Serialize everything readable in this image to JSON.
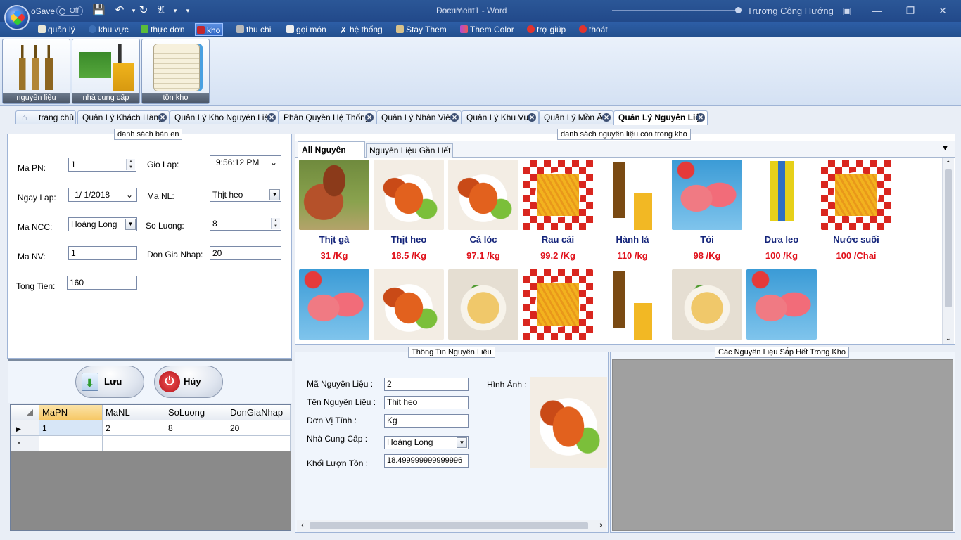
{
  "titlebar": {
    "autosave_label": "oSave",
    "autosave_state": "Off",
    "document_title": "Document1 - Word",
    "app_overlay": "FormMain",
    "user_name": "Trương Công Hướng"
  },
  "menu": [
    {
      "label": "quản lý",
      "icon": "book-icon",
      "color": "#e9e6d6"
    },
    {
      "label": "khu vực",
      "icon": "globe-icon",
      "color": "#3d6fb5"
    },
    {
      "label": "thực đơn",
      "icon": "menu-card-icon",
      "color": "#5bbd3a"
    },
    {
      "label": "kho",
      "icon": "warehouse-icon",
      "color": "#c2262e"
    },
    {
      "label": "thu chi",
      "icon": "pen-icon",
      "color": "#b8b8b8"
    },
    {
      "label": "gọi món",
      "icon": "phone-icon",
      "color": "#ededed"
    },
    {
      "label": "hệ thống",
      "icon": "tools-icon",
      "color": "#ffffff"
    },
    {
      "label": "Stay Them",
      "icon": "brush-icon",
      "color": "#d9c28a"
    },
    {
      "label": "Them Color",
      "icon": "palette-icon",
      "color": "#b44ad1"
    },
    {
      "label": "trợ giúp",
      "icon": "lifebuoy-icon",
      "color": "#e2342e"
    },
    {
      "label": "thoát",
      "icon": "close-circle-icon",
      "color": "#e2342e"
    }
  ],
  "ribbon": [
    {
      "label": "nguyên liệu",
      "icon": "bottles-icon"
    },
    {
      "label": "nhà cung cấp",
      "icon": "forklift-icon"
    },
    {
      "label": "tồn kho",
      "icon": "notebook-icon"
    }
  ],
  "tabs": [
    {
      "label": "trang chủ",
      "closable": false
    },
    {
      "label": "Quản Lý Khách Hàng",
      "closable": true
    },
    {
      "label": "Quản Lý Kho Nguyên Liệu",
      "closable": true
    },
    {
      "label": "Phân Quyền Hệ Thống",
      "closable": true
    },
    {
      "label": "Quản Lý Nhân Viên",
      "closable": true
    },
    {
      "label": "Quản Lý Khu Vực",
      "closable": true
    },
    {
      "label": "Quản Lý Mồn Ăn",
      "closable": true
    },
    {
      "label": "Quản Lý Nguyên Liệu",
      "closable": true,
      "active": true
    }
  ],
  "form": {
    "legend": "danh sách bàn en",
    "ma_pn_label": "Ma PN:",
    "ma_pn": "1",
    "gio_lap_label": "Gio Lap:",
    "gio_lap": "9:56:12 PM",
    "ngay_lap_label": "Ngay Lap:",
    "ngay_lap": "1/  1/2018",
    "ma_nl_label": "Ma NL:",
    "ma_nl": "Thịt heo",
    "ma_ncc_label": "Ma NCC:",
    "ma_ncc": "Hoàng Long",
    "so_luong_label": "So Luong:",
    "so_luong": "8",
    "ma_nv_label": "Ma NV:",
    "ma_nv": "1",
    "don_gia_label": "Don Gia Nhap:",
    "don_gia": "20",
    "tong_tien_label": "Tong Tien:",
    "tong_tien": "160",
    "save_label": "Lưu",
    "cancel_label": "Hủy"
  },
  "grid": {
    "columns": [
      "MaPN",
      "MaNL",
      "SoLuong",
      "DonGiaNhap"
    ],
    "rows": [
      [
        "1",
        "2",
        "8",
        "20"
      ]
    ]
  },
  "catalog": {
    "legend": "danh sách nguyên liệu còn trong kho",
    "tab_all": "All Nguyên Liệu",
    "tab_low": "Nguyên Liệu Gần Hết",
    "items": [
      {
        "name": "Thịt gà",
        "price": "31 /Kg",
        "img": "chicken"
      },
      {
        "name": "Thịt heo",
        "price": "18.5 /Kg",
        "img": "lobster"
      },
      {
        "name": "Cá lóc",
        "price": "97.1 /kg",
        "img": "lobster"
      },
      {
        "name": "Rau cải",
        "price": "99.2 /Kg",
        "img": "fries"
      },
      {
        "name": "Hành lá",
        "price": "110 /kg",
        "img": "beer"
      },
      {
        "name": "Tỏi",
        "price": "98 /Kg",
        "img": "juice"
      },
      {
        "name": "Dưa leo",
        "price": "100 /Kg",
        "img": "can"
      },
      {
        "name": "Nước suối",
        "price": "100 /Chai",
        "img": "fries"
      },
      {
        "name": "",
        "price": "",
        "img": "juice"
      },
      {
        "name": "",
        "price": "",
        "img": "lobster"
      },
      {
        "name": "",
        "price": "",
        "img": "soup"
      },
      {
        "name": "",
        "price": "",
        "img": "fries"
      },
      {
        "name": "",
        "price": "",
        "img": "beer"
      },
      {
        "name": "",
        "price": "",
        "img": "soup"
      },
      {
        "name": "",
        "price": "",
        "img": "juice"
      }
    ]
  },
  "detail": {
    "legend": "Thông Tin Nguyên Liệu",
    "ma_label": "Mã Nguyên Liệu :",
    "ma": "2",
    "ten_label": "Tên Nguyên Liệu :",
    "ten": "Thịt heo",
    "dvt_label": "Đơn Vị Tính :",
    "dvt": "Kg",
    "ncc_label": "Nhà Cung Cấp :",
    "ncc": "Hoàng Long",
    "ton_label": "Khối Lượn Tồn :",
    "ton": "18.499999999999996",
    "image_label": "Hình Ảnh :"
  },
  "low_stock": {
    "legend": "Các Nguyên Liệu Sắp Hết Trong Kho"
  },
  "colors": {
    "title_bar": "#2b5797",
    "name_text": "#14247a",
    "price_text": "#e0101a",
    "grid_header_selected": "#f9d68f"
  }
}
